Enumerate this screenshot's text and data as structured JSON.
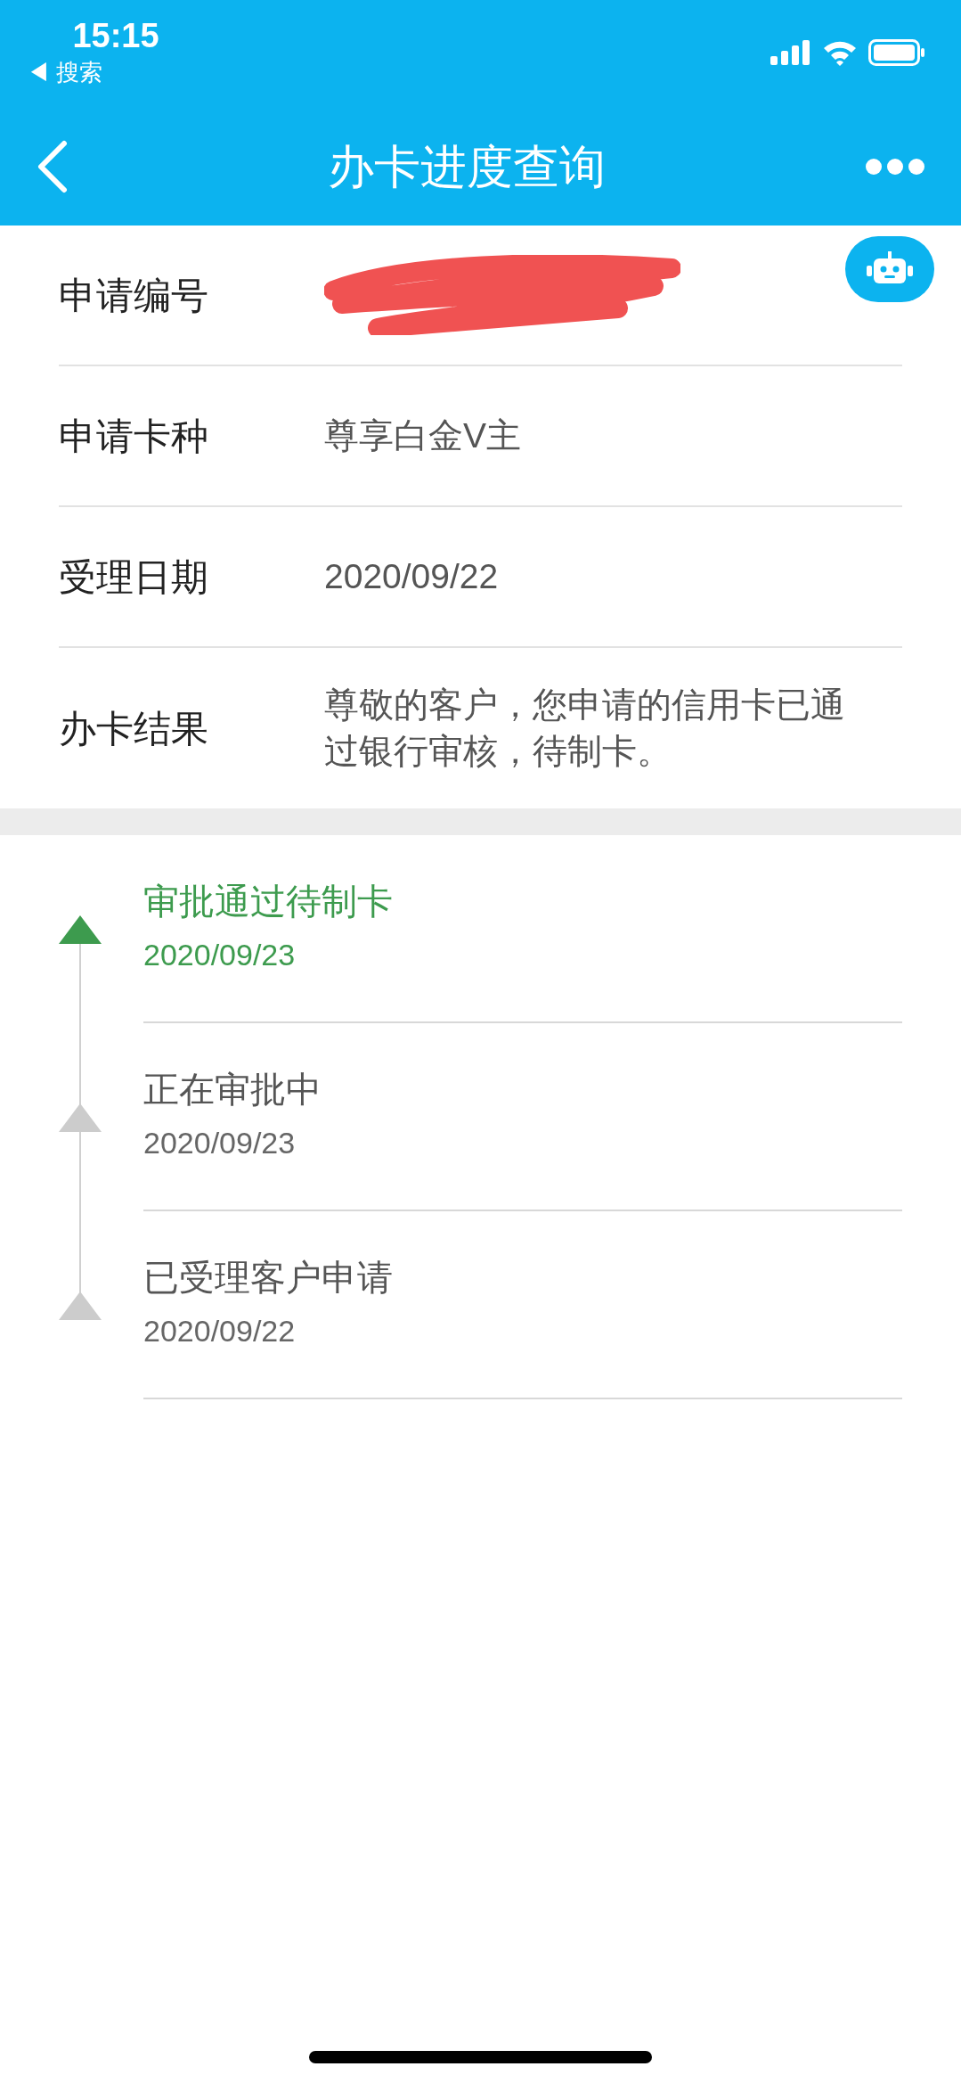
{
  "status_bar": {
    "time": "15:15",
    "back_link": "◀ 搜索"
  },
  "nav": {
    "title": "办卡进度查询"
  },
  "fields": [
    {
      "label": "申请编号",
      "kind": "redacted"
    },
    {
      "label": "申请卡种",
      "value": "尊享白金V主",
      "kind": "text"
    },
    {
      "label": "受理日期",
      "value": "2020/09/22",
      "kind": "text"
    },
    {
      "label": "办卡结果",
      "value": "尊敬的客户，您申请的信用卡已通过银行审核，待制卡。",
      "kind": "text"
    }
  ],
  "timeline": [
    {
      "title": "审批通过待制卡",
      "date": "2020/09/23",
      "selected": true
    },
    {
      "title": "正在审批中",
      "date": "2020/09/23",
      "selected": false
    },
    {
      "title": "已受理客户申请",
      "date": "2020/09/22",
      "selected": false
    }
  ]
}
